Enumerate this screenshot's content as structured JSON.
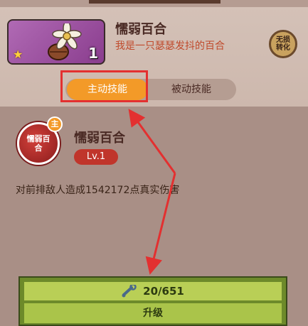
{
  "hero": {
    "name": "懦弱百合",
    "description": "我是一只瑟瑟发抖的百合",
    "count": "1",
    "convert_label_line1": "无损",
    "convert_label_line2": "转化"
  },
  "tabs": [
    {
      "label": "主动技能",
      "active": true
    },
    {
      "label": "被动技能",
      "active": false
    }
  ],
  "skill": {
    "icon_text": "懦弱百合",
    "badge": "主",
    "name": "懦弱百合",
    "level": "Lv.1",
    "effect": "对前排敌人造成1542172点真实伤害"
  },
  "upgrade": {
    "progress_text": "20/651",
    "progress_current": 20,
    "progress_total": 651,
    "button_label": "升级"
  },
  "colors": {
    "active_tab": "#f39a28",
    "highlight": "#e33030",
    "level_badge": "#c0352b",
    "upgrade_panel": "#aac44a"
  }
}
